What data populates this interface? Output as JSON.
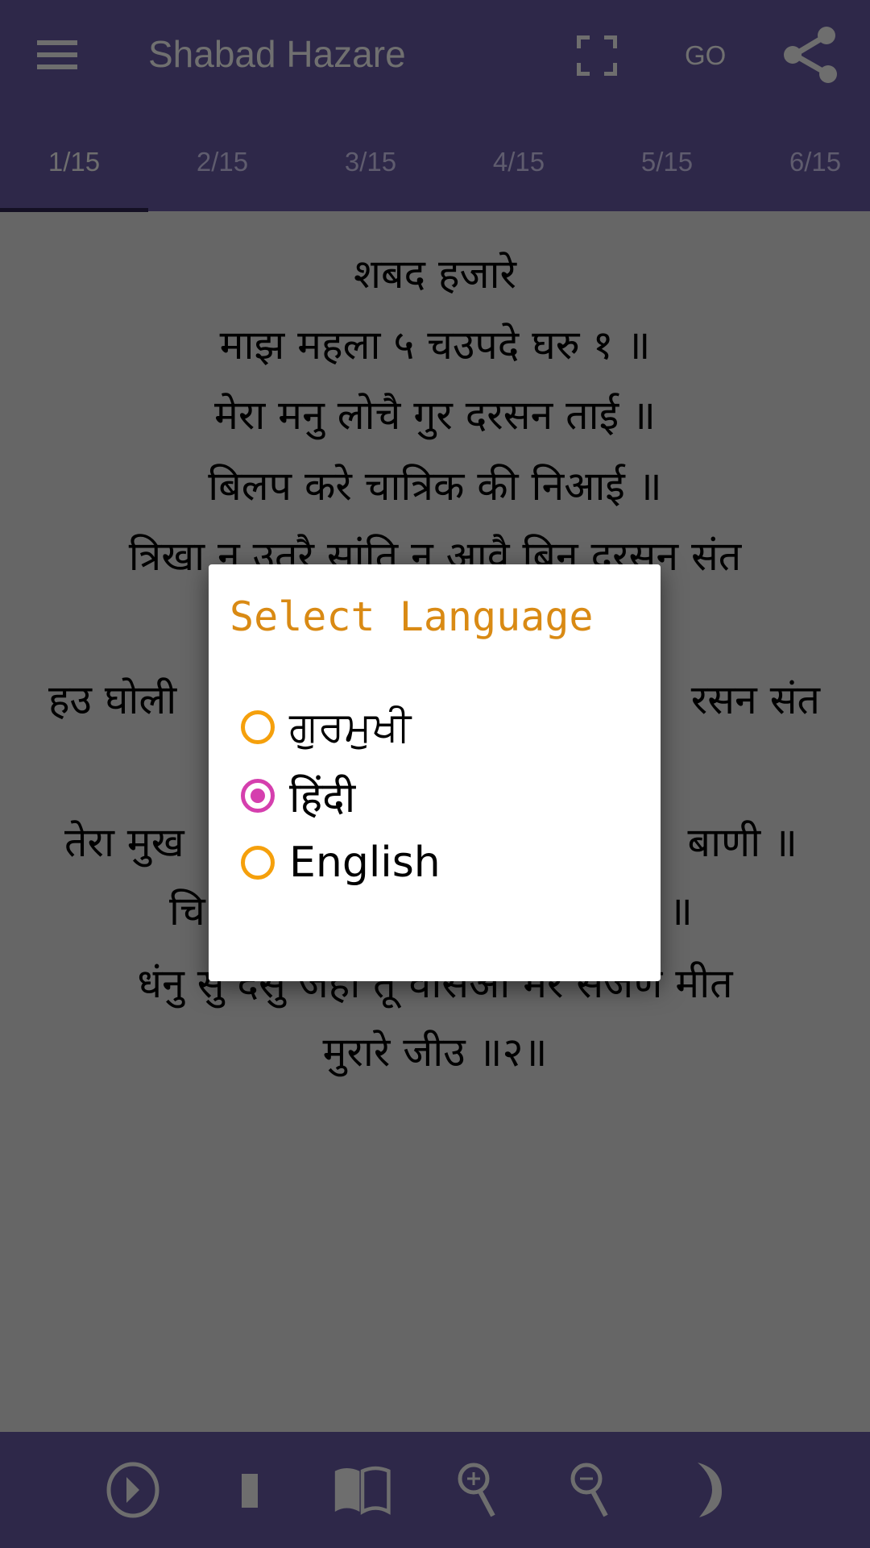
{
  "app_bar": {
    "title": "Shabad Hazare",
    "go_label": "GO",
    "icons": [
      "menu-icon",
      "fullscreen-icon",
      "share-icon"
    ]
  },
  "tabs": [
    {
      "label": "1/15",
      "active": true
    },
    {
      "label": "2/15"
    },
    {
      "label": "3/15"
    },
    {
      "label": "4/15"
    },
    {
      "label": "5/15"
    },
    {
      "label": "6/15"
    }
  ],
  "content": {
    "lines": [
      "शबद हजारे",
      "माझ महला ५ चउपदे घरु १ ॥",
      "मेरा मनु लोचै गुर दरसन ताई ॥",
      "बिलप करे चात्रिक की निआई ॥",
      "त्रिखा न उतरै सांति न आवै बिनु दरसन संत",
      "धंनु सु देसु जहा तू वसिआ मेरे सजण मीत",
      "मुरारे जीउ ॥२॥"
    ],
    "partial_lines": [
      {
        "left": "हउ घोली",
        "right": "रसन संत"
      },
      {
        "left": "तेरा मुख",
        "right": "बाणी ॥"
      },
      {
        "left": "चि",
        "right": "॥"
      }
    ]
  },
  "dialog": {
    "title": "Select Language",
    "options": [
      {
        "label": "ਗੁਰਮੁਖੀ",
        "selected": false
      },
      {
        "label": "हिंदी",
        "selected": true
      },
      {
        "label": "English",
        "selected": false
      }
    ]
  },
  "bottom_bar": {
    "icons": [
      "play-icon",
      "stop-icon",
      "book-icon",
      "zoom-in-icon",
      "zoom-out-icon",
      "night-mode-icon"
    ]
  },
  "colors": {
    "app_bar": "#2e2849",
    "content_bg_dimmed": "#666666",
    "dialog_title": "#d98a14",
    "radio_unselected": "#f5a00c",
    "radio_selected": "#d53fae"
  }
}
